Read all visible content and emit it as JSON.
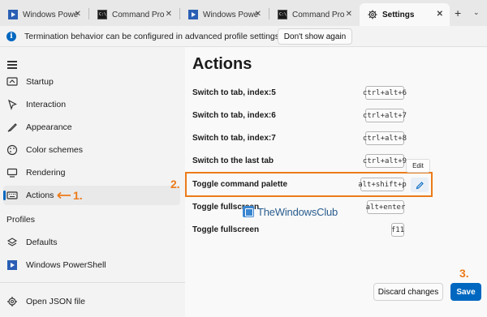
{
  "tabs": [
    {
      "label": "Windows Powe",
      "icon": "powershell-icon"
    },
    {
      "label": "Command Pro",
      "icon": "command-prompt-icon"
    },
    {
      "label": "Windows Powe",
      "icon": "powershell-icon"
    },
    {
      "label": "Command Pro",
      "icon": "command-prompt-icon"
    },
    {
      "label": "Settings",
      "icon": "gear-icon"
    }
  ],
  "tab_new": "+",
  "tab_dropdown": "⌄",
  "tab_close": "✕",
  "info": {
    "text": "Termination behavior can be configured in advanced profile settings.",
    "button": "Don't show again",
    "icon": "i"
  },
  "sidebar": {
    "items": [
      {
        "label": "Startup",
        "icon": "startup-icon"
      },
      {
        "label": "Interaction",
        "icon": "interaction-icon"
      },
      {
        "label": "Appearance",
        "icon": "appearance-icon"
      },
      {
        "label": "Color schemes",
        "icon": "color-schemes-icon"
      },
      {
        "label": "Rendering",
        "icon": "rendering-icon"
      },
      {
        "label": "Actions",
        "icon": "keyboard-icon"
      }
    ],
    "profiles_header": "Profiles",
    "profiles": [
      {
        "label": "Defaults",
        "icon": "layers-icon"
      },
      {
        "label": "Windows PowerShell",
        "icon": "powershell-icon"
      }
    ],
    "open_json": "Open JSON file"
  },
  "annotations": {
    "one": "1.",
    "two": "2.",
    "three": "3."
  },
  "main": {
    "title": "Actions",
    "rows": [
      {
        "label": "Switch to tab, index:5",
        "key": "ctrl+alt+6"
      },
      {
        "label": "Switch to tab, index:6",
        "key": "ctrl+alt+7"
      },
      {
        "label": "Switch to tab, index:7",
        "key": "ctrl+alt+8"
      },
      {
        "label": "Switch to the last tab",
        "key": "ctrl+alt+9"
      },
      {
        "label": "Toggle command palette",
        "key": "alt+shift+p"
      },
      {
        "label": "Toggle fullscreen",
        "key": "alt+enter"
      },
      {
        "label": "Toggle fullscreen",
        "key": "f11"
      }
    ],
    "edit_tooltip": "Edit",
    "watermark": "TheWindowsClub"
  },
  "footer": {
    "discard": "Discard changes",
    "save": "Save"
  },
  "colors": {
    "accent": "#0067c0",
    "annotation": "#ec7b1a"
  }
}
